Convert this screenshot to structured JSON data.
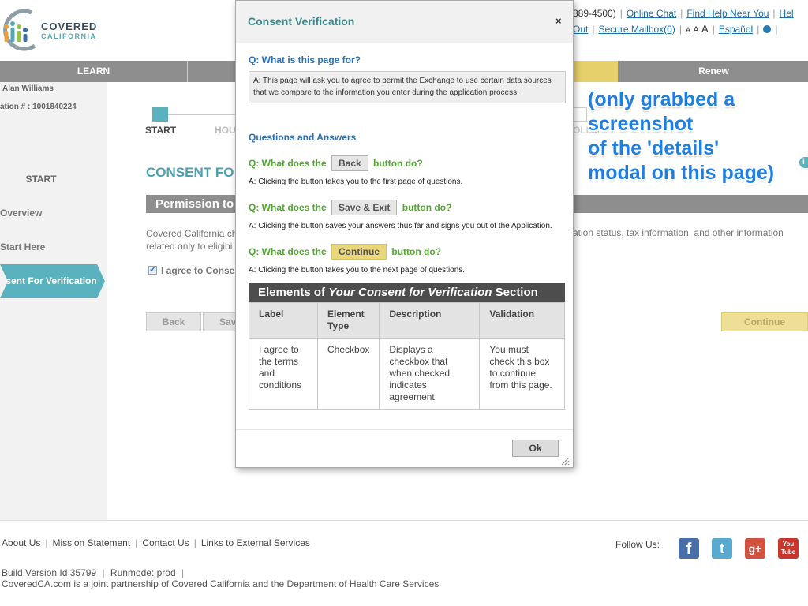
{
  "brand": {
    "line1": "COVERED",
    "line2": "CALIFORNIA",
    "accent": "#5ab2be"
  },
  "utility": {
    "phone_fragment": "889-4500)",
    "online_chat": "Online Chat",
    "find_help": "Find Help Near You",
    "help_fragment": "Hel",
    "logout_fragment": "Out",
    "secure_mailbox": "Secure Mailbox(0)",
    "font_small": "A",
    "font_mid": "A",
    "font_big": "A",
    "espanol": "Español"
  },
  "nav": {
    "learn": "LEARN",
    "renew": "Renew"
  },
  "sidebar": {
    "user_name": "Alan Williams",
    "app_id": "ation # : 1001840224",
    "start": "START",
    "overview": "Overview",
    "start_here": "Start Here",
    "consent": "nsent For Verification"
  },
  "progress": {
    "start": "START",
    "hou": "HOU",
    "oll": "OLLM"
  },
  "main": {
    "title_fragment": "CONSENT FO",
    "permission_fragment": "Permission to",
    "body_line1": "Covered California ch",
    "body_line2": "related only to eligibi",
    "body_right": "ation status, tax information, and other information",
    "agree_fragment": "I agree to Conse",
    "back": "Back",
    "save_fragment": "Sav",
    "continue": "Continue",
    "info": "i"
  },
  "annotation": {
    "line1": "(only grabbed a",
    "line2": "screenshot",
    "line3": "of the 'details'",
    "line4": "modal on this page)"
  },
  "modal": {
    "title": "Consent Verification",
    "close": "×",
    "q_page": "Q: What is this page for?",
    "a_page": "A: This page will ask you to agree to permit the Exchange to use certain data sources that we compare to the information you enter during the application process.",
    "qa_heading": "Questions and Answers",
    "q_prefix": "Q: What does the",
    "q_suffix": "button do?",
    "btn_back": "Back",
    "btn_save_exit": "Save & Exit",
    "btn_continue": "Continue",
    "a_back": "A: Clicking the button takes you to the first page of questions.",
    "a_save": "A: Clicking the button saves your answers thus far and signs you out of the Application.",
    "a_continue": "A: Clicking the button takes you to the next page of questions.",
    "elements_prefix": "Elements of",
    "elements_italic": "Your Consent for Verification",
    "elements_suffix": "Section",
    "table": {
      "headers": [
        "Label",
        "Element Type",
        "Description",
        "Validation"
      ],
      "rows": [
        [
          "I agree to the terms and conditions",
          "Checkbox",
          "Displays a checkbox that when checked indicates agreement",
          "You must check this box to continue from this page."
        ]
      ]
    },
    "ok": "Ok"
  },
  "footer": {
    "about": "About Us",
    "mission": "Mission Statement",
    "contact": "Contact Us",
    "links": "Links to External Services",
    "follow": "Follow Us:",
    "build": "Build Version Id 35799",
    "runmode": "Runmode: prod",
    "partnership": "CoveredCA.com is a joint partnership of Covered California and the Department of Health Care Services"
  },
  "social": {
    "fb": "f",
    "tw": "t",
    "gp": "g+",
    "yt1": "You",
    "yt2": "Tube"
  }
}
